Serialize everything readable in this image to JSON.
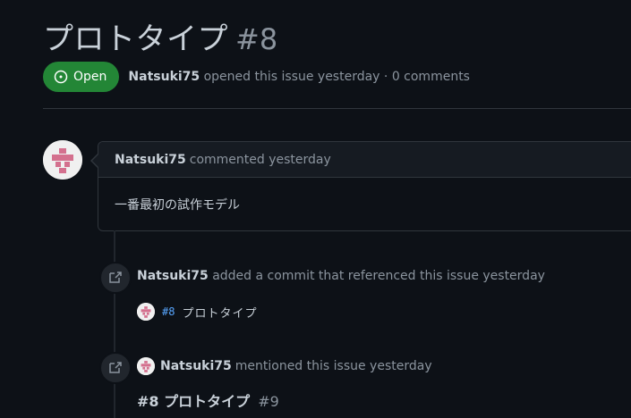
{
  "issue": {
    "title": "プロトタイプ",
    "number": "#8",
    "state": "Open",
    "author": "Natsuki75",
    "opened_text": "opened this issue yesterday · 0 comments"
  },
  "colors": {
    "open_green": "#238636",
    "link_blue": "#58a6ff",
    "background": "#0d1117"
  },
  "comment": {
    "author": "Natsuki75",
    "meta": "commented yesterday",
    "body": "一番最初の試作モデル"
  },
  "timeline": {
    "commit_event": {
      "icon": "cross-reference-icon",
      "author": "Natsuki75",
      "text": "added a commit that referenced this issue yesterday",
      "commit_ref": "#8",
      "commit_message": "プロトタイプ"
    },
    "mention_event": {
      "icon": "cross-reference-icon",
      "author": "Natsuki75",
      "text": "mentioned this issue yesterday",
      "ref_title": "#8 プロトタイプ",
      "ref_number": "#9"
    }
  }
}
